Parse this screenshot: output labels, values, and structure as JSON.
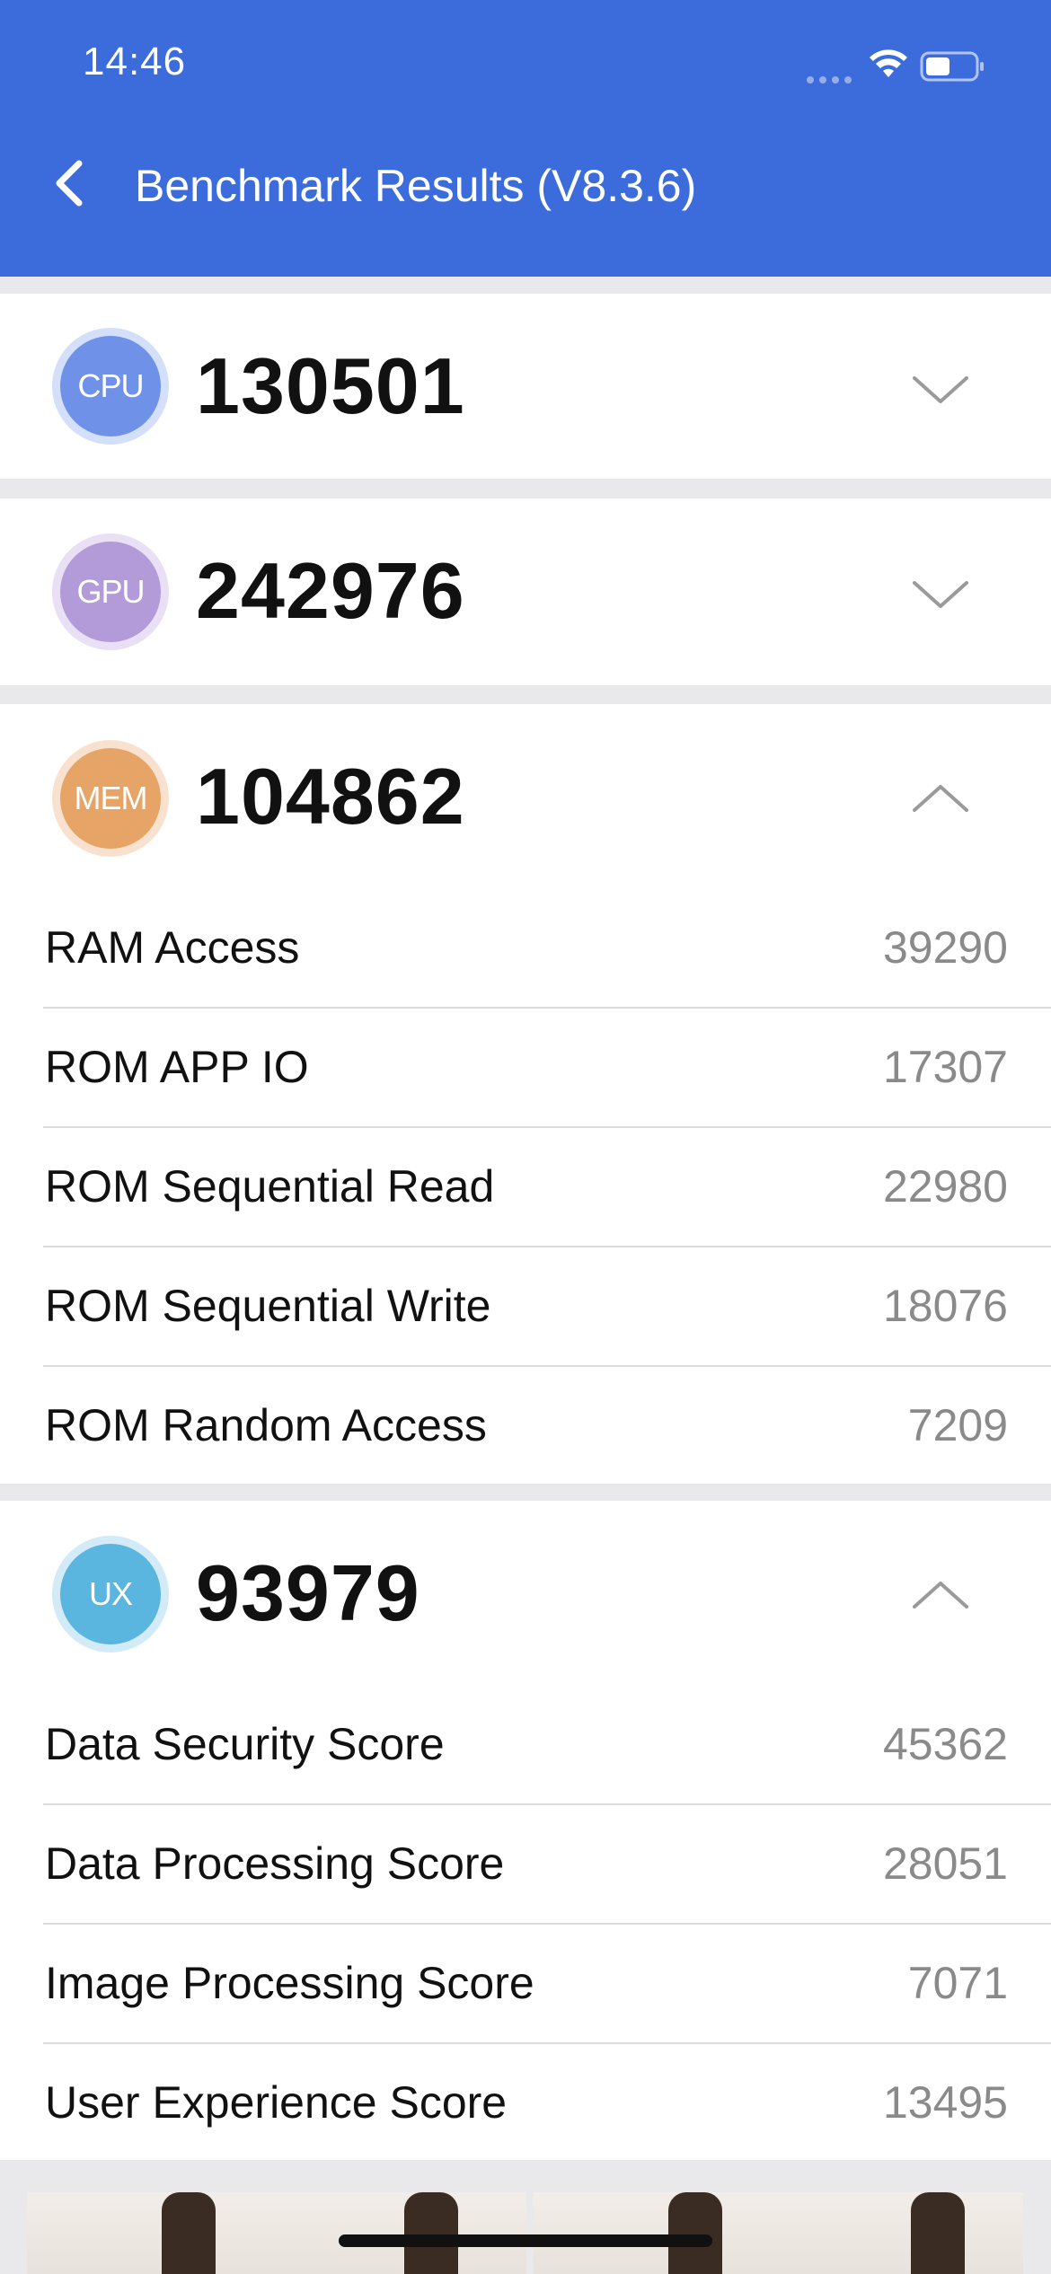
{
  "status_bar": {
    "time": "14:46"
  },
  "header": {
    "title": "Benchmark Results (V8.3.6)"
  },
  "sections": {
    "cpu": {
      "badge": "CPU",
      "score": "130501",
      "badge_color": "#6f92e8",
      "ring_color": "#d4e0fa",
      "expanded": false
    },
    "gpu": {
      "badge": "GPU",
      "score": "242976",
      "badge_color": "#b39ad9",
      "ring_color": "#e9e0f5",
      "expanded": false
    },
    "mem": {
      "badge": "MEM",
      "score": "104862",
      "badge_color": "#e6a467",
      "ring_color": "#f8e2cf",
      "expanded": true,
      "items": [
        {
          "label": "RAM Access",
          "value": "39290"
        },
        {
          "label": "ROM APP IO",
          "value": "17307"
        },
        {
          "label": "ROM Sequential Read",
          "value": "22980"
        },
        {
          "label": "ROM Sequential Write",
          "value": "18076"
        },
        {
          "label": "ROM Random Access",
          "value": "7209"
        }
      ]
    },
    "ux": {
      "badge": "UX",
      "score": "93979",
      "badge_color": "#5ab5df",
      "ring_color": "#d2ebf7",
      "expanded": true,
      "items": [
        {
          "label": "Data Security Score",
          "value": "45362"
        },
        {
          "label": "Data Processing Score",
          "value": "28051"
        },
        {
          "label": "Image Processing Score",
          "value": "7071"
        },
        {
          "label": "User Experience Score",
          "value": "13495"
        }
      ]
    }
  },
  "icons": {
    "back": "chevron-left-icon",
    "collapsed": "chevron-down-icon",
    "expanded": "chevron-up-icon",
    "wifi": "wifi-icon",
    "battery": "battery-icon"
  },
  "colors": {
    "header": "#3c6cdb",
    "background": "#e9e9eb",
    "value_text": "#8a8a8a"
  }
}
